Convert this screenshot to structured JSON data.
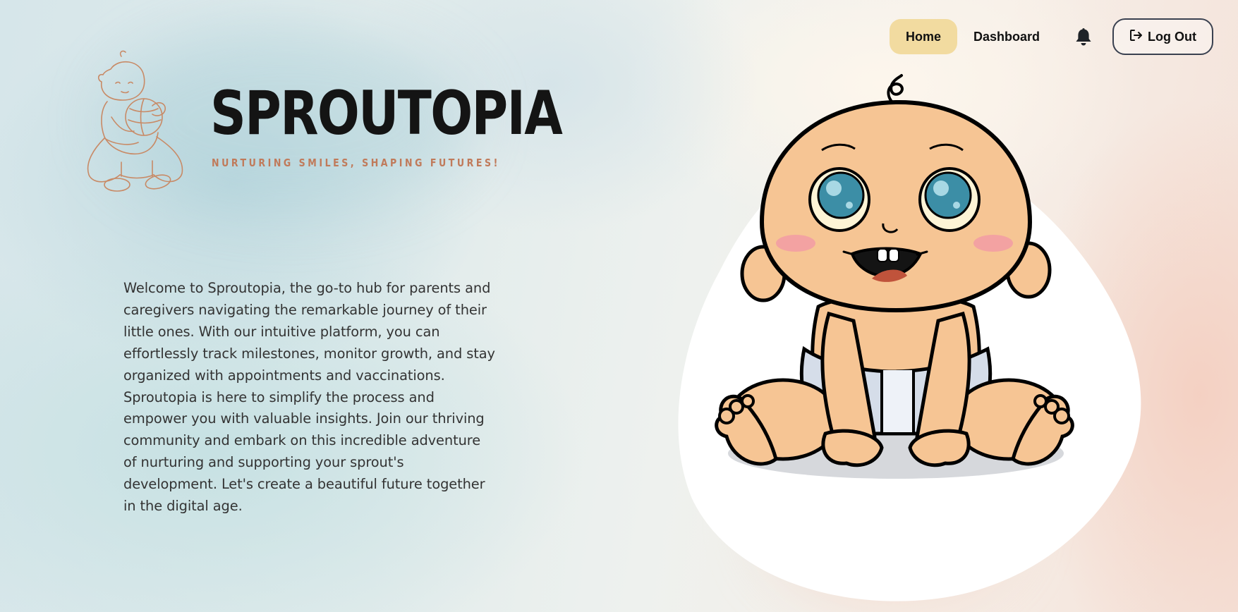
{
  "nav": {
    "home_label": "Home",
    "dashboard_label": "Dashboard",
    "logout_label": "Log Out",
    "notification_icon": "bell-icon",
    "logout_icon": "sign-out-icon",
    "active_color": "#f2dba0"
  },
  "brand": {
    "name": "SPROUTOPIA",
    "tagline": "NURTURING SMILES, SHAPING FUTURES!",
    "logo_icon": "baby-outline-logo",
    "tagline_color": "#c07a5a"
  },
  "intro": {
    "text": "Welcome to Sproutopia, the go-to hub for parents and caregivers navigating the remarkable journey of their little ones. With our intuitive platform, you can effortlessly track milestones, monitor growth, and stay organized with appointments and vaccinations. Sproutopia is here to simplify the process and empower you with valuable insights. Join our thriving community and embark on this incredible adventure of nurturing and supporting your sprout's development. Let's create a beautiful future together in the digital age."
  },
  "hero": {
    "illustration": "cartoon-baby-illustration"
  }
}
